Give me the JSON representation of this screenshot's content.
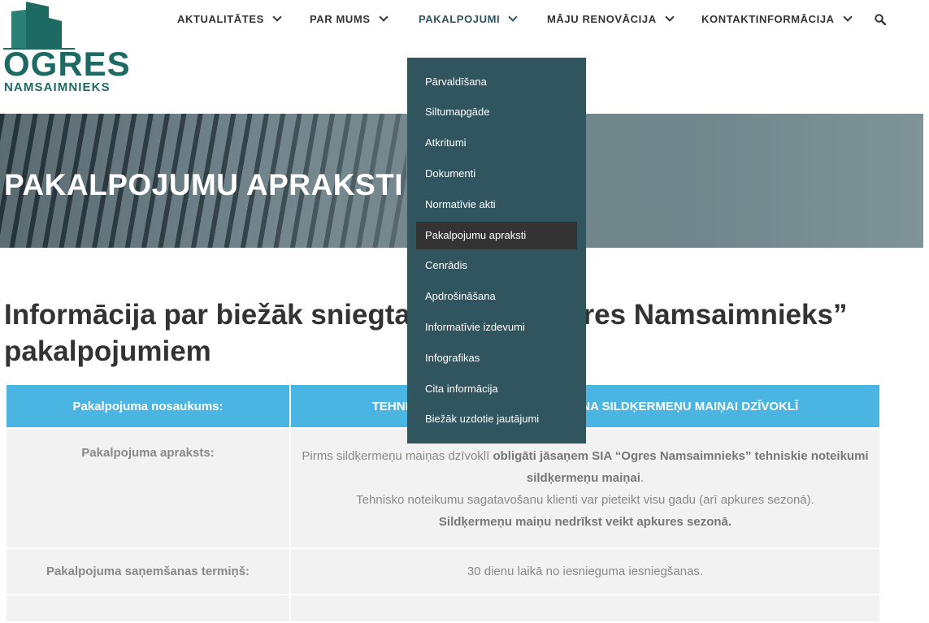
{
  "logo": {
    "title": "OGRES",
    "subtitle": "NAMSAIMNIEKS"
  },
  "nav": {
    "items": [
      {
        "label": "AKTUALITĀTES"
      },
      {
        "label": "PAR MUMS"
      },
      {
        "label": "PAKALPOJUMI"
      },
      {
        "label": "MĀJU RENOVĀCIJA"
      },
      {
        "label": "KONTAKTINFORMĀCIJA"
      }
    ],
    "search_icon": "search-icon"
  },
  "hero": {
    "title": "PAKALPOJUMU APRAKSTI"
  },
  "heading": "Informācija par biežāk sniegtajiem SIA “Ogres Namsaimnieks” pakalpojumiem",
  "dropdown": {
    "items": [
      "Pārvaldīšana",
      "Siltumapgāde",
      "Atkritumi",
      "Dokumenti",
      "Normatīvie akti",
      "Pakalpojumu apraksti",
      "Cenrādis",
      "Apdrošināšana",
      "Informatīvie izdevumi",
      "Infografikas",
      "Cita informācija",
      "Biežāk uzdotie jautājumi"
    ],
    "selected": "Pakalpojumu apraksti"
  },
  "table": {
    "header_left": "Pakalpojuma nosaukums:",
    "header_right": "TEHNISKO NOTEIKUMU IZSNIEGŠANA SILDĶERMEŅU MAIŅAI DZĪVOKLĪ",
    "rows": {
      "description_label": "Pakalpojuma apraksts:",
      "description_line1_pre": "Pirms sildķermeņu maiņas dzīvoklī ",
      "description_line1_bold": "obligāti jāsaņem SIA “Ogres Namsaimnieks” tehniskie noteikumi sildķermeņu maiņai",
      "description_line1_post": ".",
      "description_line2": "Tehnisko noteikumu sagatavošanu klienti var pieteikt visu gadu (arī apkures sezonā).",
      "description_line3": "Sildķermeņu maiņu nedrīkst veikt apkures sezonā.",
      "term_label": "Pakalpojuma saņemšanas termiņš:",
      "term_value": "30 dienu laikā no iesnieguma iesniegšanas."
    }
  },
  "colors": {
    "brand_green": "#1d6a62",
    "dropdown_bg": "#30555f",
    "dropdown_selected": "#333333",
    "table_header": "#4ab5e2"
  }
}
